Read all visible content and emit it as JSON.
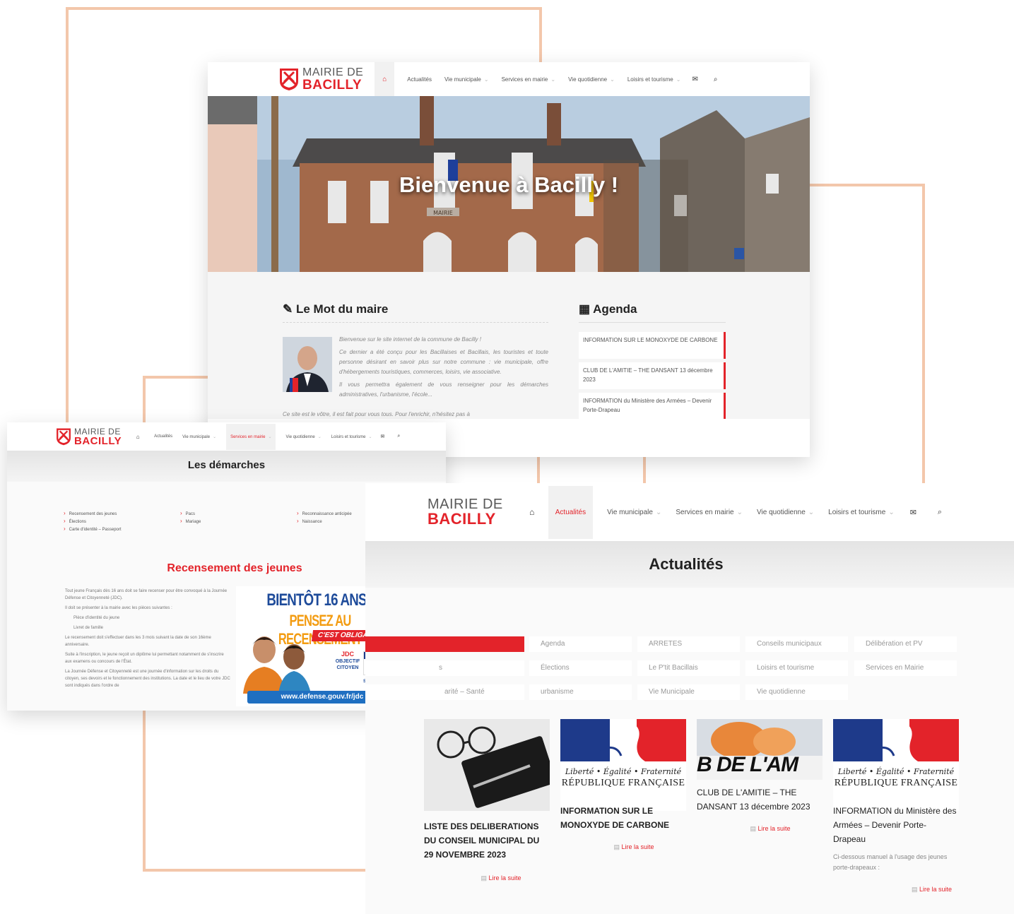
{
  "site": {
    "logo_line1": "MAIRIE DE",
    "logo_line2": "BACILLY"
  },
  "nav": {
    "items": [
      "Actualités",
      "Vie municipale",
      "Services en mairie",
      "Vie quotidienne",
      "Loisirs et tourisme"
    ],
    "icons": [
      "home-icon",
      "mail-icon",
      "search-icon"
    ]
  },
  "home": {
    "hero_title": "Bienvenue à Bacilly !",
    "mairie_sign": "MAIRIE",
    "mot_title": "Le Mot du maire",
    "mot_p1": "Bienvenue sur le site internet de la commune de Bacilly !",
    "mot_p2": "Ce dernier a été conçu pour les Bacillaises et Bacillais, les touristes et toute personne désirant en savoir plus sur notre commune : vie municipale, offre d'hébergements touristiques, commerces, loisirs, vie associative.",
    "mot_p3": "Il vous permettra également de vous renseigner pour les démarches administratives, l'urbanisme, l'école...",
    "mot_p4": "Ce site est le vôtre, il est fait pour vous tous. Pour l'enrichir, n'hésitez pas à",
    "agenda_title": "Agenda",
    "agenda_items": [
      "INFORMATION SUR LE MONOXYDE DE CARBONE",
      "CLUB DE L'AMITIE – THE DANSANT 13 décembre 2023",
      "INFORMATION du Ministère des Armées – Devenir Porte-Drapeau"
    ]
  },
  "demarches": {
    "active_nav": "Services en mairie",
    "banner_title": "Les démarches",
    "links": [
      "Recensement des jeunes",
      "Élections",
      "Carte d'identité – Passeport",
      "Pacs",
      "Mariage",
      "Reconnaissance anticipée",
      "Naissance"
    ],
    "section_title": "Recensement des jeunes",
    "body": [
      "Tout jeune Français dès 16 ans doit se faire recenser pour être convoqué à la Journée Défense et Citoyenneté (JDC).",
      "Il doit se présenter à la mairie avec les pièces suivantes :",
      "Pièce d'identité du jeune",
      "Livret de famille",
      "Le recensement doit s'effectuer dans les 3 mois suivant la date de son 16ème anniversaire.",
      "Suite à l'inscription, le jeune reçoit un diplôme lui permettant notamment de s'inscrire aux examens ou concours de l'État.",
      "La Journée Défense et Citoyenneté est une journée d'information sur les droits du citoyen, ses devoirs et le fonctionnement des institutions. La date et le lieu de votre JDC sont indiqués dans l'ordre de"
    ],
    "poster_line1": "BIENTÔT 16 ANS !",
    "poster_line2": "PENSEZ AU RECENSEMENT",
    "poster_line3": "C'EST OBLIGATOIRE",
    "poster_badge1": "JDC",
    "poster_badge2": "OBJECTIF CITOYEN",
    "poster_badge3": "SGA",
    "poster_url": "www.defense.gouv.fr/jdc"
  },
  "actualites": {
    "active_nav": "Actualités",
    "banner_title": "Actualités",
    "categories": [
      "",
      "Agenda",
      "ARRETES",
      "Conseils municipaux",
      "Délibération et PV",
      "s",
      "Élections",
      "Le P'tit Bacillais",
      "Loisirs et tourisme",
      "Services en Mairie",
      "arité – Santé",
      "urbanisme",
      "Vie Municipale",
      "Vie quotidienne"
    ],
    "rf_motto": "Liberté • Égalité • Fraternité",
    "rf_name": "RÉPUBLIQUE FRANÇAISE",
    "club_banner": "B DE L'AM",
    "read_more": "Lire la suite",
    "cards": [
      {
        "title": "LISTE DES DELIBERATIONS DU CONSEIL MUNICIPAL DU 29 NOVEMBRE 2023",
        "excerpt": ""
      },
      {
        "title": "INFORMATION SUR LE MONOXYDE DE CARBONE",
        "excerpt": ""
      },
      {
        "title": "CLUB DE L'AMITIE – THE DANSANT 13 décembre 2023",
        "excerpt": ""
      },
      {
        "title": "INFORMATION du Ministère des Armées – Devenir Porte-Drapeau",
        "excerpt": "Ci-dessous manuel à l'usage des jeunes porte-drapeaux :"
      }
    ]
  },
  "colors": {
    "brand_red": "#e3232a",
    "accent_peach": "#f3c7ab",
    "rf_blue": "#1e3a8a"
  }
}
